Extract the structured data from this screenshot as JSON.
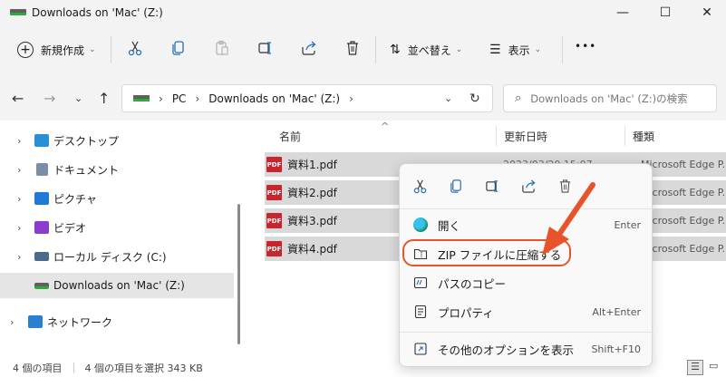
{
  "window": {
    "title": "Downloads on 'Mac' (Z:)",
    "minimize_glyph": "—",
    "maximize_glyph": "☐",
    "close_glyph": "✕"
  },
  "toolbar": {
    "new_label": "新規作成",
    "sort_label": "並べ替え",
    "view_label": "表示",
    "more_label": "•••",
    "caret": "⌄"
  },
  "address": {
    "pc": "PC",
    "location": "Downloads on 'Mac' (Z:)",
    "sep": "›",
    "dropdown": "⌄",
    "refresh": "↻"
  },
  "search": {
    "placeholder": "Downloads on 'Mac' (Z:)の検索"
  },
  "nav": {
    "back": "←",
    "forward": "→",
    "recent": "⌄",
    "up": "↑"
  },
  "sidebar": {
    "items": [
      {
        "label": "デスクトップ",
        "icon": "desktop-icon",
        "color": "#2a8fd8"
      },
      {
        "label": "ドキュメント",
        "icon": "document-icon",
        "color": "#7a8ea8"
      },
      {
        "label": "ピクチャ",
        "icon": "pictures-icon",
        "color": "#1d7ad6"
      },
      {
        "label": "ビデオ",
        "icon": "video-icon",
        "color": "#8a3ccf"
      },
      {
        "label": "ローカル ディスク (C:)",
        "icon": "local-disk-icon",
        "color": "#4a6a8a"
      },
      {
        "label": "Downloads on 'Mac' (Z:)",
        "icon": "network-drive-icon",
        "color": "#2eaa3a"
      },
      {
        "label": "ネットワーク",
        "icon": "network-icon",
        "color": "#2a7fcf"
      }
    ],
    "chevron": "›"
  },
  "columns": {
    "name": "名前",
    "date": "更新日時",
    "type": "種類",
    "sort_arrow": "^"
  },
  "files": [
    {
      "name": "資料1.pdf",
      "date": "2023/03/20 15:07",
      "type": "Microsoft Edge P..."
    },
    {
      "name": "資料2.pdf",
      "date": "",
      "type": "Microsoft Edge P..."
    },
    {
      "name": "資料3.pdf",
      "date": "",
      "type": "Microsoft Edge P..."
    },
    {
      "name": "資料4.pdf",
      "date": "",
      "type": "Microsoft Edge P..."
    }
  ],
  "pdf_badge": "PDF",
  "context_menu": {
    "items": [
      {
        "label": "開く",
        "shortcut": "Enter",
        "icon": "edge-icon"
      },
      {
        "label": "ZIP ファイルに圧縮する",
        "shortcut": "",
        "icon": "zip-folder-icon"
      },
      {
        "label": "パスのコピー",
        "shortcut": "",
        "icon": "copy-path-icon"
      },
      {
        "label": "プロパティ",
        "shortcut": "Alt+Enter",
        "icon": "properties-icon"
      },
      {
        "label": "その他のオプションを表示",
        "shortcut": "Shift+F10",
        "icon": "more-options-icon"
      }
    ]
  },
  "status": {
    "count": "4 個の項目",
    "selected": "4 個の項目を選択  343 KB"
  },
  "colors": {
    "accent": "#e8542a",
    "pdf": "#c8262f",
    "chrome": "#f3f3f3"
  }
}
